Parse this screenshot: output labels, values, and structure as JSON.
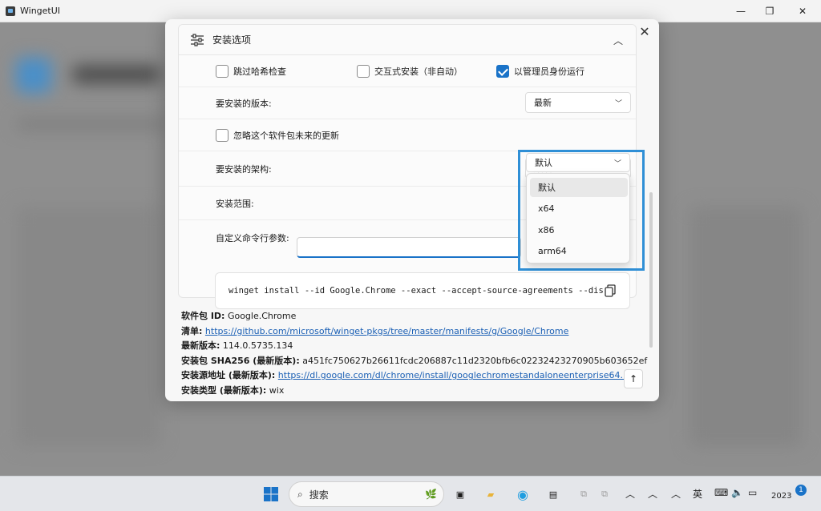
{
  "window": {
    "title": "WingetUI",
    "minimize_icon": "minimize-icon",
    "maximize_icon": "restore-icon",
    "close_icon": "close-icon"
  },
  "dialog": {
    "options": {
      "title": "安装选项",
      "checkboxes": [
        {
          "label": "跳过哈希检查",
          "checked": false
        },
        {
          "label": "交互式安装（非自动）",
          "checked": false
        },
        {
          "label": "以管理员身份运行",
          "checked": true
        }
      ],
      "version_label": "要安装的版本:",
      "version_value": "最新",
      "ignore_updates_label": "忽略这个软件包未来的更新",
      "ignore_updates_checked": false,
      "arch_label": "要安装的架构:",
      "arch_value": "默认",
      "scope_label": "安装范围:",
      "custom_args_label": "自定义命令行参数:",
      "custom_args_value": "",
      "command": "winget install --id Google.Chrome --exact --accept-source-agreements --dis"
    },
    "arch_dropdown": {
      "options": [
        "默认",
        "x64",
        "x86",
        "arm64"
      ],
      "selected": "默认"
    },
    "info": {
      "package_id_label": "软件包 ID:",
      "package_id": "Google.Chrome",
      "manifest_label": "清单:",
      "manifest_url": "https://github.com/microsoft/winget-pkgs/tree/master/manifests/g/Google/Chrome",
      "latest_version_label": "最新版本:",
      "latest_version": "114.0.5735.134",
      "sha256_label": "安装包 SHA256 (最新版本):",
      "sha256": "a451fc750627b26611fcdc206887c11d2320bfb6c02232423270905b603652ef",
      "installer_url_label": "安装源地址 (最新版本):",
      "installer_url": "https://dl.google.com/dl/chrome/install/googlechromestandaloneenterprise64.msi",
      "installer_type_label": "安装类型 (最新版本):",
      "installer_type": "wix"
    }
  },
  "taskbar": {
    "search_placeholder": "搜索",
    "ime_indicator": "英",
    "clock_year": "2023",
    "notification_count": "1"
  },
  "colors": {
    "accent": "#1a73c8",
    "highlight_frame": "#2f8fd6"
  }
}
